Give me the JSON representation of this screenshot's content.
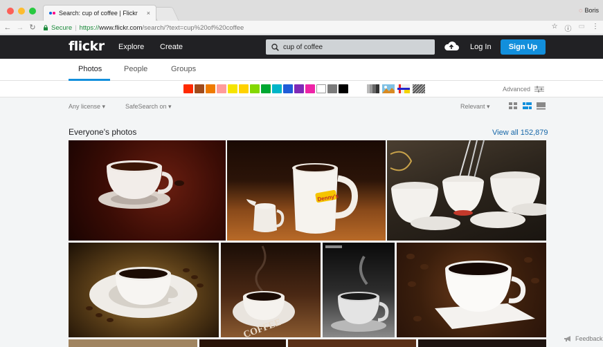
{
  "browser": {
    "tab_title": "Search: cup of coffee | Flickr",
    "tab_close": "×",
    "profile_name": "Boris",
    "secure_label": "Secure",
    "url_scheme": "https://",
    "url_host": "www.flickr.com",
    "url_path": "/search/?text=cup%20of%20coffee"
  },
  "header": {
    "logo": "flickr",
    "nav_explore": "Explore",
    "nav_create": "Create",
    "search_value": "cup of coffee",
    "login": "Log In",
    "signup": "Sign Up"
  },
  "subnav": {
    "tabs": [
      {
        "label": "Photos"
      },
      {
        "label": "People"
      },
      {
        "label": "Groups"
      }
    ]
  },
  "color_filters": [
    "#ff2a00",
    "#a04b1c",
    "#ef7b00",
    "#ff9b9b",
    "#f5e400",
    "#ffd200",
    "#84d800",
    "#00a832",
    "#00b5c8",
    "#1f5cd8",
    "#7f2ab6",
    "#ee24a7",
    "#ffffff",
    "#7b7b7b",
    "#000000"
  ],
  "advanced": "Advanced",
  "filters": {
    "license": "Any license ▾",
    "safesearch": "SafeSearch on ▾",
    "sort": "Relevant ▾"
  },
  "section": {
    "title": "Everyone's photos",
    "view_all": "View all 152,879"
  },
  "feedback": "Feedback"
}
